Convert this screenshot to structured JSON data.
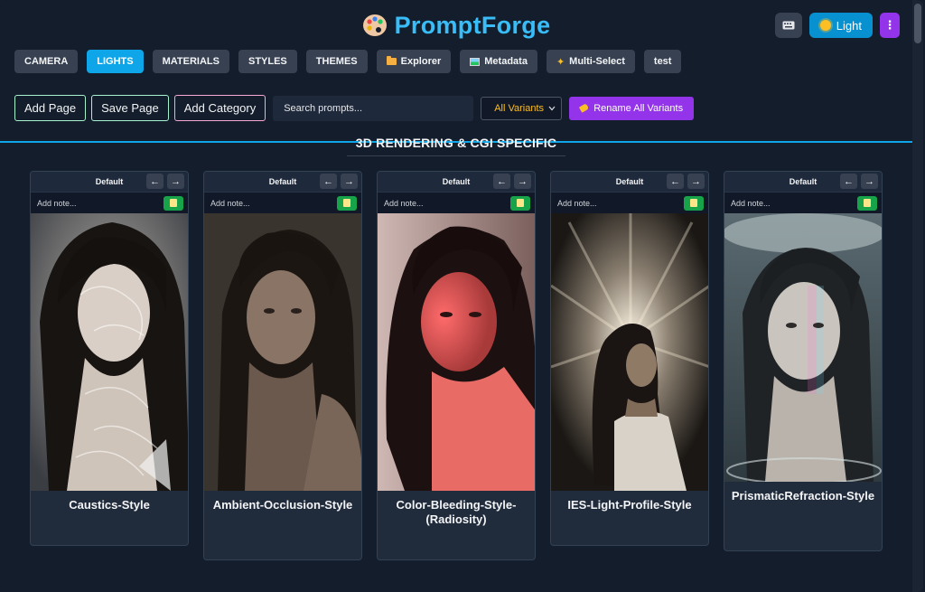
{
  "app": {
    "title": "PromptForge"
  },
  "topbar": {
    "light_label": "Light",
    "menu_glyph": "⋮"
  },
  "nav": [
    {
      "label": "CAMERA",
      "active": false
    },
    {
      "label": "LIGHTS",
      "active": true
    },
    {
      "label": "MATERIALS",
      "active": false
    },
    {
      "label": "STYLES",
      "active": false
    },
    {
      "label": "THEMES",
      "active": false
    },
    {
      "label": "Explorer",
      "icon": "folder-icon"
    },
    {
      "label": "Metadata",
      "icon": "picture-icon"
    },
    {
      "label": "Multi-Select",
      "icon": "sparkle-icon"
    },
    {
      "label": "test"
    }
  ],
  "toolbar": {
    "add_page": "Add Page",
    "save_page": "Save Page",
    "add_category": "Add Category",
    "search_placeholder": "Search prompts...",
    "variant_selected": "All Variants",
    "rename_all": "Rename All Variants"
  },
  "section": {
    "title": "3D RENDERING & CGI SPECIFIC"
  },
  "cards": [
    {
      "variant": "Default",
      "note_placeholder": "Add note...",
      "title": "Caustics-Style"
    },
    {
      "variant": "Default",
      "note_placeholder": "Add note...",
      "title": "Ambient-Occlusion-Style"
    },
    {
      "variant": "Default",
      "note_placeholder": "Add note...",
      "title": "Color-Bleeding-Style-(Radiosity)"
    },
    {
      "variant": "Default",
      "note_placeholder": "Add note...",
      "title": "IES-Light-Profile-Style"
    },
    {
      "variant": "Default",
      "note_placeholder": "Add note...",
      "title": "PrismaticRefraction-Style"
    }
  ],
  "arrows": {
    "left": "←",
    "right": "→"
  },
  "colors": {
    "accent": "#38bdf8",
    "active_tab": "#0ea5e9",
    "purple": "#9333ea",
    "save_green": "#16a34a"
  }
}
